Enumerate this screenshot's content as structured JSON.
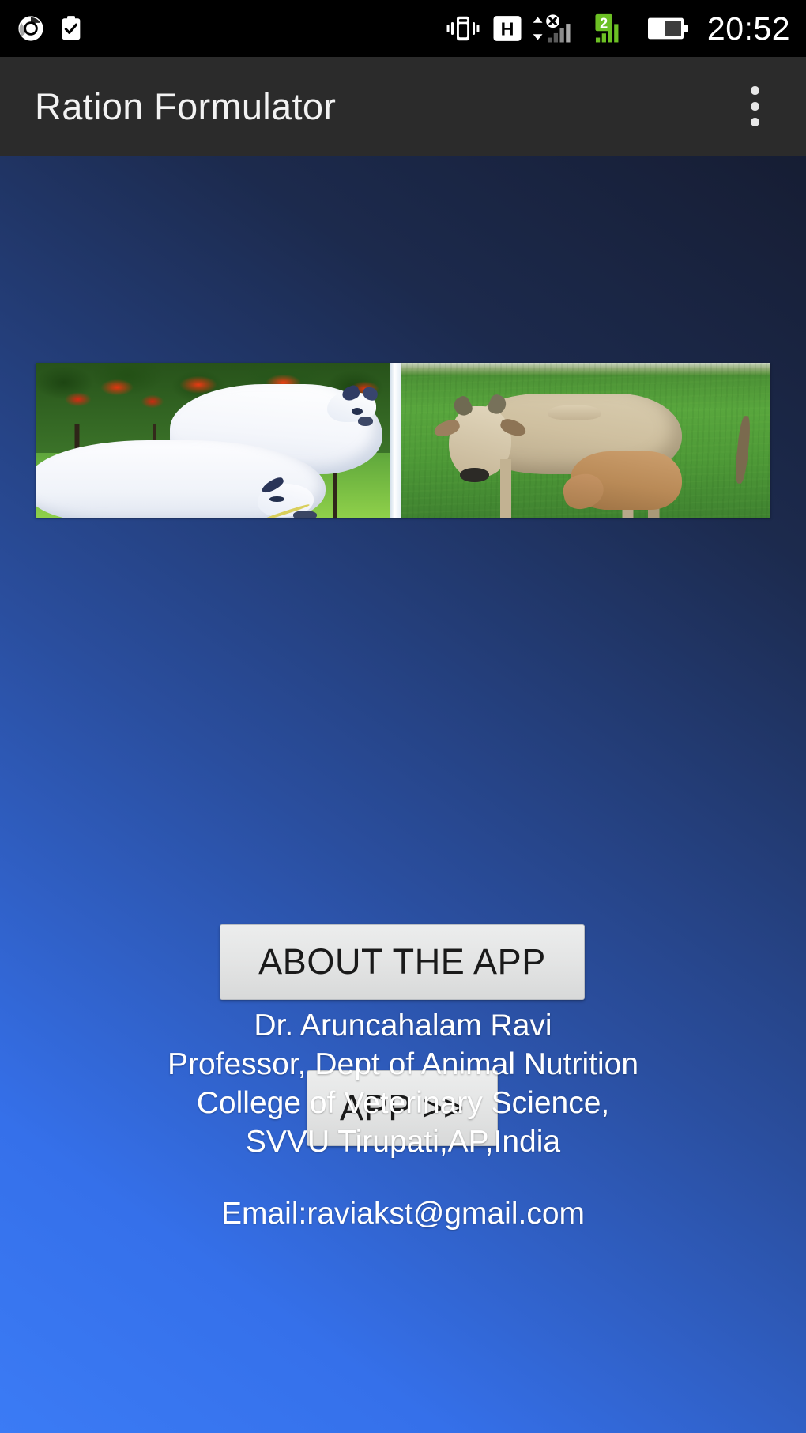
{
  "statusbar": {
    "clock": "20:52",
    "icons": [
      {
        "name": "chrome-icon",
        "label": "Chrome"
      },
      {
        "name": "clipboard-check-icon",
        "label": "Task saved"
      },
      {
        "name": "vibrate-icon",
        "label": "Vibrate mode"
      },
      {
        "name": "hspa-network-icon",
        "label": "H"
      },
      {
        "name": "no-data-signal-icon",
        "label": "SIM 1 no data"
      },
      {
        "name": "sim2-signal-icon",
        "label": "2"
      },
      {
        "name": "battery-icon",
        "label": "Battery"
      }
    ],
    "hspa_label": "H",
    "sim_label": "2",
    "battery_level": "50"
  },
  "appbar": {
    "title": "Ration Formulator",
    "overflow_label": "More options"
  },
  "banner": {
    "alt_left": "White Ongole cattle under red flowering trees",
    "alt_right": "Tan zebu cow nursing a calf on green pasture"
  },
  "buttons": {
    "about": "ABOUT THE APP",
    "app": "APP >>"
  },
  "credits": {
    "name": "Dr. Aruncahalam Ravi",
    "position": "Professor, Dept of Animal Nutrition",
    "college": "College of Veterinary Science,",
    "university": "SVVU Tirupati,AP,India",
    "email": "Email:raviakst@gmail.com"
  },
  "colors": {
    "statusbar_bg": "#000000",
    "appbar_bg": "#2b2b2b",
    "appbar_text": "#f2f2f2",
    "bg_dark": "#161d33",
    "bg_light": "#3b7bf5",
    "button_face": "#e3e4e4",
    "button_text": "#1a1a1a",
    "sim_accent": "#6cc024"
  }
}
